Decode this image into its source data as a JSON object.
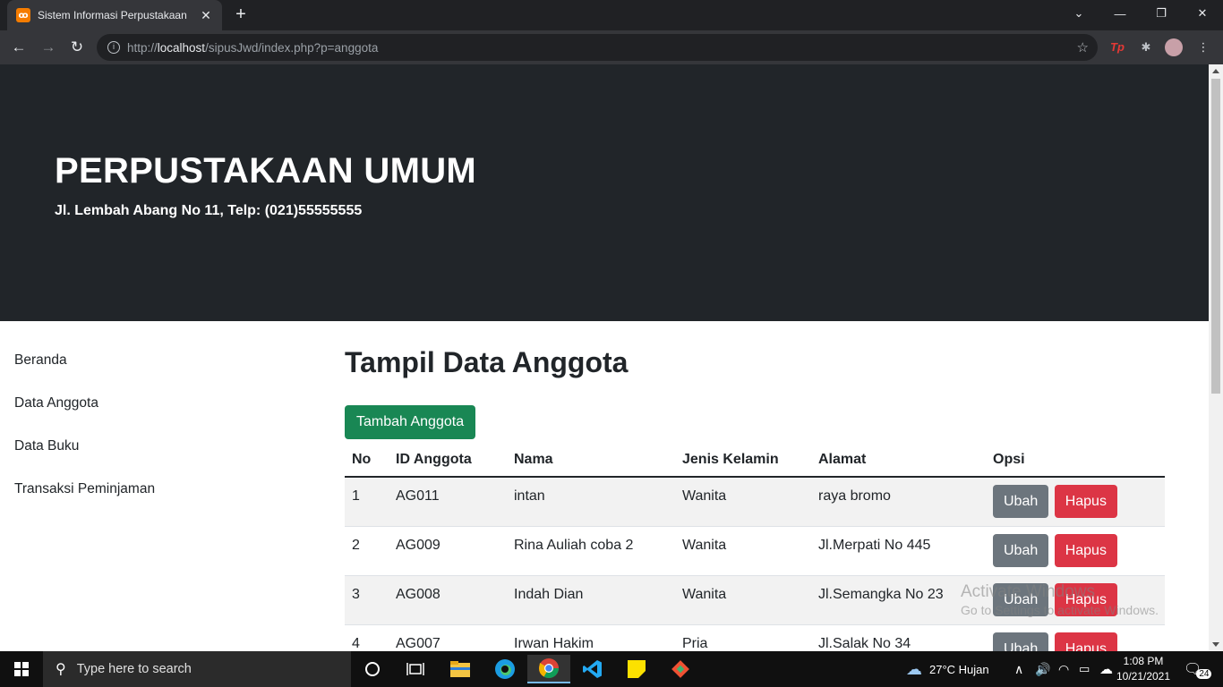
{
  "browser": {
    "tab_title": "Sistem Informasi Perpustakaan",
    "tab_close": "✕",
    "new_tab": "+",
    "url_prefix": "http://",
    "url_host": "localhost",
    "url_path": "/sipusJwd/index.php?p=anggota"
  },
  "header": {
    "title": "PERPUSTAKAAN UMUM",
    "subtitle": "Jl. Lembah Abang No 11, Telp: (021)55555555"
  },
  "sidebar": {
    "items": [
      {
        "label": "Beranda"
      },
      {
        "label": "Data Anggota"
      },
      {
        "label": "Data Buku"
      },
      {
        "label": "Transaksi Peminjaman"
      }
    ]
  },
  "main": {
    "title": "Tampil Data Anggota",
    "add_button": "Tambah Anggota",
    "columns": [
      "No",
      "ID Anggota",
      "Nama",
      "Jenis Kelamin",
      "Alamat",
      "Opsi"
    ],
    "edit_label": "Ubah",
    "delete_label": "Hapus",
    "rows": [
      {
        "no": "1",
        "id": "AG011",
        "nama": "intan",
        "jk": "Wanita",
        "alamat": "raya bromo"
      },
      {
        "no": "2",
        "id": "AG009",
        "nama": "Rina Auliah coba 2",
        "jk": "Wanita",
        "alamat": "Jl.Merpati No 445"
      },
      {
        "no": "3",
        "id": "AG008",
        "nama": "Indah Dian",
        "jk": "Wanita",
        "alamat": "Jl.Semangka No 23"
      },
      {
        "no": "4",
        "id": "AG007",
        "nama": "Irwan Hakim",
        "jk": "Pria",
        "alamat": "Jl.Salak No 34"
      }
    ]
  },
  "watermark": {
    "line1": "Activate Windows",
    "line2": "Go to Settings to activate Windows."
  },
  "taskbar": {
    "search_placeholder": "Type here to search",
    "weather": "27°C  Hujan",
    "time": "1:08 PM",
    "date": "10/21/2021",
    "notification_count": "24"
  },
  "colors": {
    "header_bg": "#212529",
    "add_button": "#198754",
    "edit_button": "#6c757d",
    "delete_button": "#dc3545"
  }
}
